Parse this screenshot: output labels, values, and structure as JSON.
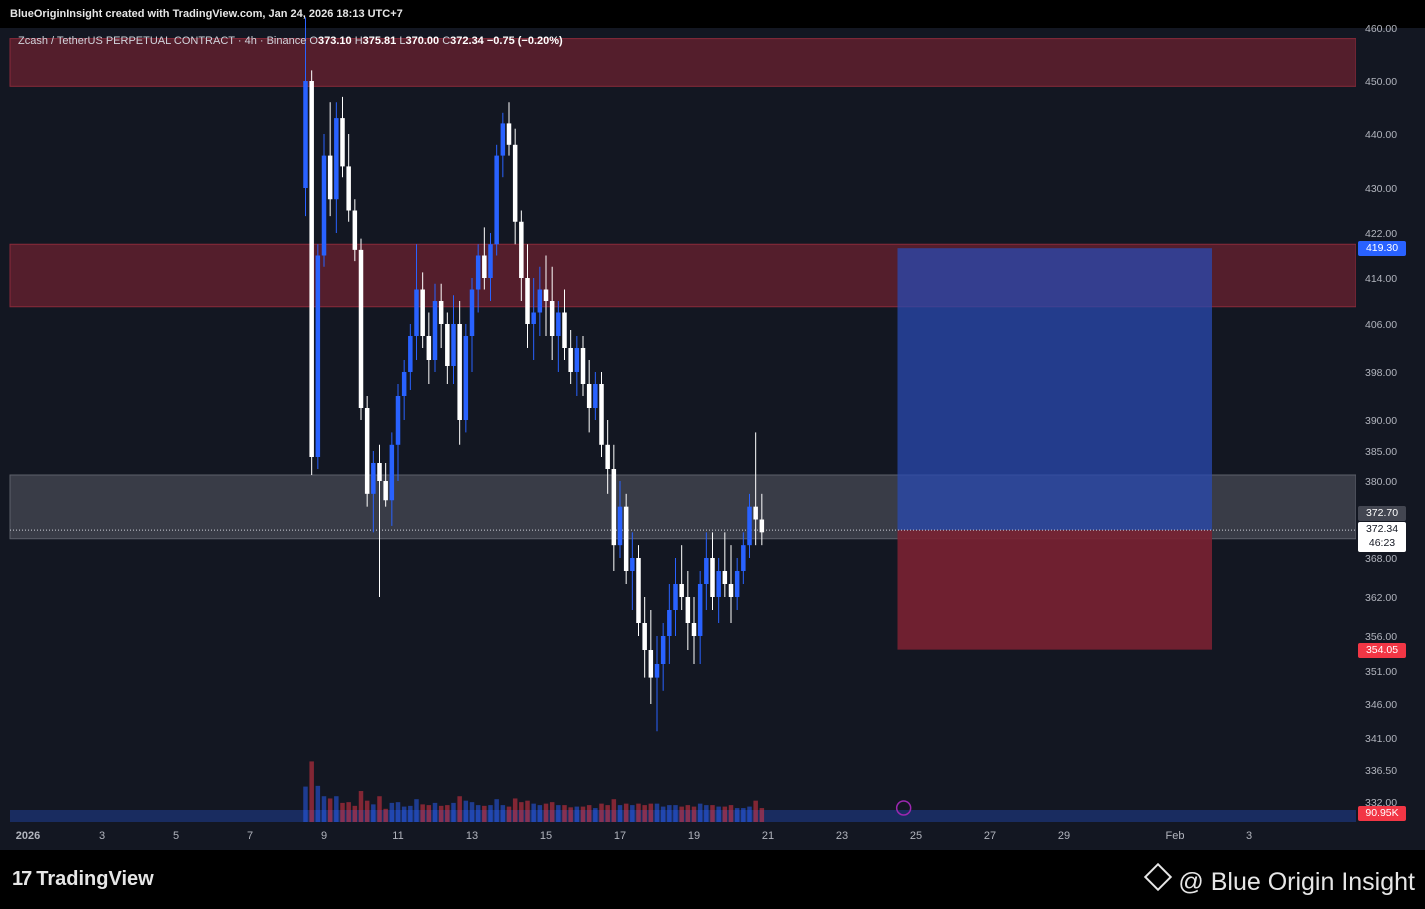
{
  "header": {
    "created_text": "BlueOriginInsight created with TradingView.com, Jan 24, 2026 18:13 UTC+7"
  },
  "legend": {
    "symbol": "Zcash / TetherUS PERPETUAL CONTRACT · 4h · Binance",
    "o_label": "O",
    "o_value": "373.10",
    "h_label": "H",
    "h_value": "375.81",
    "l_label": "L",
    "l_value": "370.00",
    "c_label": "C",
    "c_value": "372.34",
    "change": "−0.75 (−0.20%)"
  },
  "price_axis": {
    "ticks": [
      "460.00",
      "450.00",
      "440.00",
      "430.00",
      "422.00",
      "414.00",
      "406.00",
      "398.00",
      "390.00",
      "385.00",
      "380.00",
      "368.00",
      "362.00",
      "356.00",
      "351.00",
      "346.00",
      "341.00",
      "336.50",
      "332.00"
    ]
  },
  "time_axis": {
    "labels": [
      "2026",
      "3",
      "5",
      "7",
      "9",
      "11",
      "13",
      "15",
      "17",
      "19",
      "21",
      "23",
      "25",
      "27",
      "29",
      "Feb",
      "3"
    ]
  },
  "badges": {
    "target": "419.30",
    "zone_price": "372.70",
    "last_price": "372.34",
    "countdown": "46:23",
    "stop": "354.05",
    "volume": "90.95K"
  },
  "colors": {
    "background": "#131722",
    "bull_candle": "#2962ff",
    "bear_candle": "#ffffff",
    "resistance_zone": "#6b2230",
    "support_zone": "#434651",
    "target_zone": "#2a4ab0",
    "stop_zone": "#7a2132"
  },
  "footer": {
    "tv_logo": "TradingView",
    "brand": "@ Blue Origin Insight"
  },
  "chart_data": {
    "type": "candlestick",
    "timeframe": "4h",
    "x_range": [
      "2026-01-01",
      "2026-02-04"
    ],
    "ylim": [
      332,
      460
    ],
    "zones": [
      {
        "kind": "resistance",
        "low": 449,
        "high": 458
      },
      {
        "kind": "resistance",
        "low": 409,
        "high": 420
      },
      {
        "kind": "support",
        "low": 371,
        "high": 381
      }
    ],
    "position": {
      "entry": 372.34,
      "target": 419.3,
      "stop": 354.05,
      "start": "2026-01-24T12:00",
      "end": "2026-02-02"
    },
    "candles": [
      [
        "2026-01-08T12:00",
        430,
        462,
        425,
        450
      ],
      [
        "2026-01-08T16:00",
        450,
        452,
        381,
        384
      ],
      [
        "2026-01-08T20:00",
        384,
        420,
        382,
        418
      ],
      [
        "2026-01-09T00:00",
        418,
        440,
        416,
        436
      ],
      [
        "2026-01-09T04:00",
        436,
        446,
        425,
        428
      ],
      [
        "2026-01-09T08:00",
        428,
        446,
        422,
        443
      ],
      [
        "2026-01-09T12:00",
        443,
        447,
        432,
        434
      ],
      [
        "2026-01-09T16:00",
        434,
        440,
        424,
        426
      ],
      [
        "2026-01-09T20:00",
        426,
        428,
        417,
        419
      ],
      [
        "2026-01-10T00:00",
        419,
        421,
        390,
        392
      ],
      [
        "2026-01-10T04:00",
        392,
        394,
        376,
        378
      ],
      [
        "2026-01-10T08:00",
        378,
        385,
        372,
        383
      ],
      [
        "2026-01-10T12:00",
        383,
        386,
        362,
        380
      ],
      [
        "2026-01-10T16:00",
        380,
        383,
        376,
        377
      ],
      [
        "2026-01-10T20:00",
        377,
        388,
        373,
        386
      ],
      [
        "2026-01-11T00:00",
        386,
        396,
        380,
        394
      ],
      [
        "2026-01-11T04:00",
        394,
        400,
        390,
        398
      ],
      [
        "2026-01-11T08:00",
        398,
        406,
        395,
        404
      ],
      [
        "2026-01-11T12:00",
        404,
        420,
        400,
        412
      ],
      [
        "2026-01-11T16:00",
        412,
        415,
        402,
        404
      ],
      [
        "2026-01-11T20:00",
        404,
        408,
        396,
        400
      ],
      [
        "2026-01-12T00:00",
        400,
        413,
        398,
        410
      ],
      [
        "2026-01-12T04:00",
        410,
        413,
        402,
        406
      ],
      [
        "2026-01-12T08:00",
        406,
        408,
        396,
        399
      ],
      [
        "2026-01-12T12:00",
        399,
        411,
        396,
        406
      ],
      [
        "2026-01-12T16:00",
        406,
        410,
        386,
        390
      ],
      [
        "2026-01-12T20:00",
        390,
        406,
        388,
        404
      ],
      [
        "2026-01-13T00:00",
        404,
        414,
        398,
        412
      ],
      [
        "2026-01-13T04:00",
        412,
        420,
        408,
        418
      ],
      [
        "2026-01-13T08:00",
        418,
        423,
        412,
        414
      ],
      [
        "2026-01-13T12:00",
        414,
        422,
        410,
        420
      ],
      [
        "2026-01-13T16:00",
        420,
        438,
        418,
        436
      ],
      [
        "2026-01-13T20:00",
        436,
        444,
        432,
        442
      ],
      [
        "2026-01-14T00:00",
        442,
        446,
        436,
        438
      ],
      [
        "2026-01-14T04:00",
        438,
        441,
        420,
        424
      ],
      [
        "2026-01-14T08:00",
        424,
        426,
        410,
        414
      ],
      [
        "2026-01-14T12:00",
        414,
        420,
        402,
        406
      ],
      [
        "2026-01-14T16:00",
        406,
        414,
        400,
        408
      ],
      [
        "2026-01-14T20:00",
        408,
        416,
        404,
        412
      ],
      [
        "2026-01-15T00:00",
        412,
        418,
        404,
        410
      ],
      [
        "2026-01-15T04:00",
        410,
        416,
        400,
        404
      ],
      [
        "2026-01-15T08:00",
        404,
        410,
        398,
        408
      ],
      [
        "2026-01-15T12:00",
        408,
        412,
        400,
        402
      ],
      [
        "2026-01-15T16:00",
        402,
        405,
        396,
        398
      ],
      [
        "2026-01-15T20:00",
        398,
        404,
        394,
        402
      ],
      [
        "2026-01-16T00:00",
        402,
        404,
        394,
        396
      ],
      [
        "2026-01-16T04:00",
        396,
        400,
        388,
        392
      ],
      [
        "2026-01-16T08:00",
        392,
        398,
        390,
        396
      ],
      [
        "2026-01-16T12:00",
        396,
        398,
        384,
        386
      ],
      [
        "2026-01-16T16:00",
        386,
        390,
        378,
        382
      ],
      [
        "2026-01-16T20:00",
        382,
        386,
        366,
        370
      ],
      [
        "2026-01-17T00:00",
        370,
        380,
        368,
        376
      ],
      [
        "2026-01-17T04:00",
        376,
        378,
        364,
        366
      ],
      [
        "2026-01-17T08:00",
        366,
        372,
        360,
        368
      ],
      [
        "2026-01-17T12:00",
        368,
        370,
        356,
        358
      ],
      [
        "2026-01-17T16:00",
        358,
        362,
        350,
        354
      ],
      [
        "2026-01-17T20:00",
        354,
        360,
        346,
        350
      ],
      [
        "2026-01-18T00:00",
        350,
        356,
        342,
        352
      ],
      [
        "2026-01-18T04:00",
        352,
        358,
        348,
        356
      ],
      [
        "2026-01-18T08:00",
        356,
        364,
        352,
        360
      ],
      [
        "2026-01-18T12:00",
        360,
        368,
        356,
        364
      ],
      [
        "2026-01-18T16:00",
        364,
        370,
        360,
        362
      ],
      [
        "2026-01-18T20:00",
        362,
        366,
        354,
        358
      ],
      [
        "2026-01-19T00:00",
        358,
        362,
        352,
        356
      ],
      [
        "2026-01-19T04:00",
        356,
        366,
        352,
        364
      ],
      [
        "2026-01-19T08:00",
        364,
        372,
        360,
        368
      ],
      [
        "2026-01-19T12:00",
        368,
        372,
        360,
        362
      ],
      [
        "2026-01-19T16:00",
        362,
        368,
        358,
        366
      ],
      [
        "2026-01-19T20:00",
        366,
        372,
        362,
        364
      ],
      [
        "2026-01-20T00:00",
        364,
        370,
        358,
        362
      ],
      [
        "2026-01-20T04:00",
        362,
        368,
        360,
        366
      ],
      [
        "2026-01-20T08:00",
        366,
        372,
        364,
        370
      ],
      [
        "2026-01-20T12:00",
        370,
        378,
        368,
        376
      ],
      [
        "2026-01-20T16:00",
        376,
        388,
        370,
        374
      ],
      [
        "2026-01-20T20:00",
        374,
        378,
        370,
        372
      ]
    ]
  }
}
